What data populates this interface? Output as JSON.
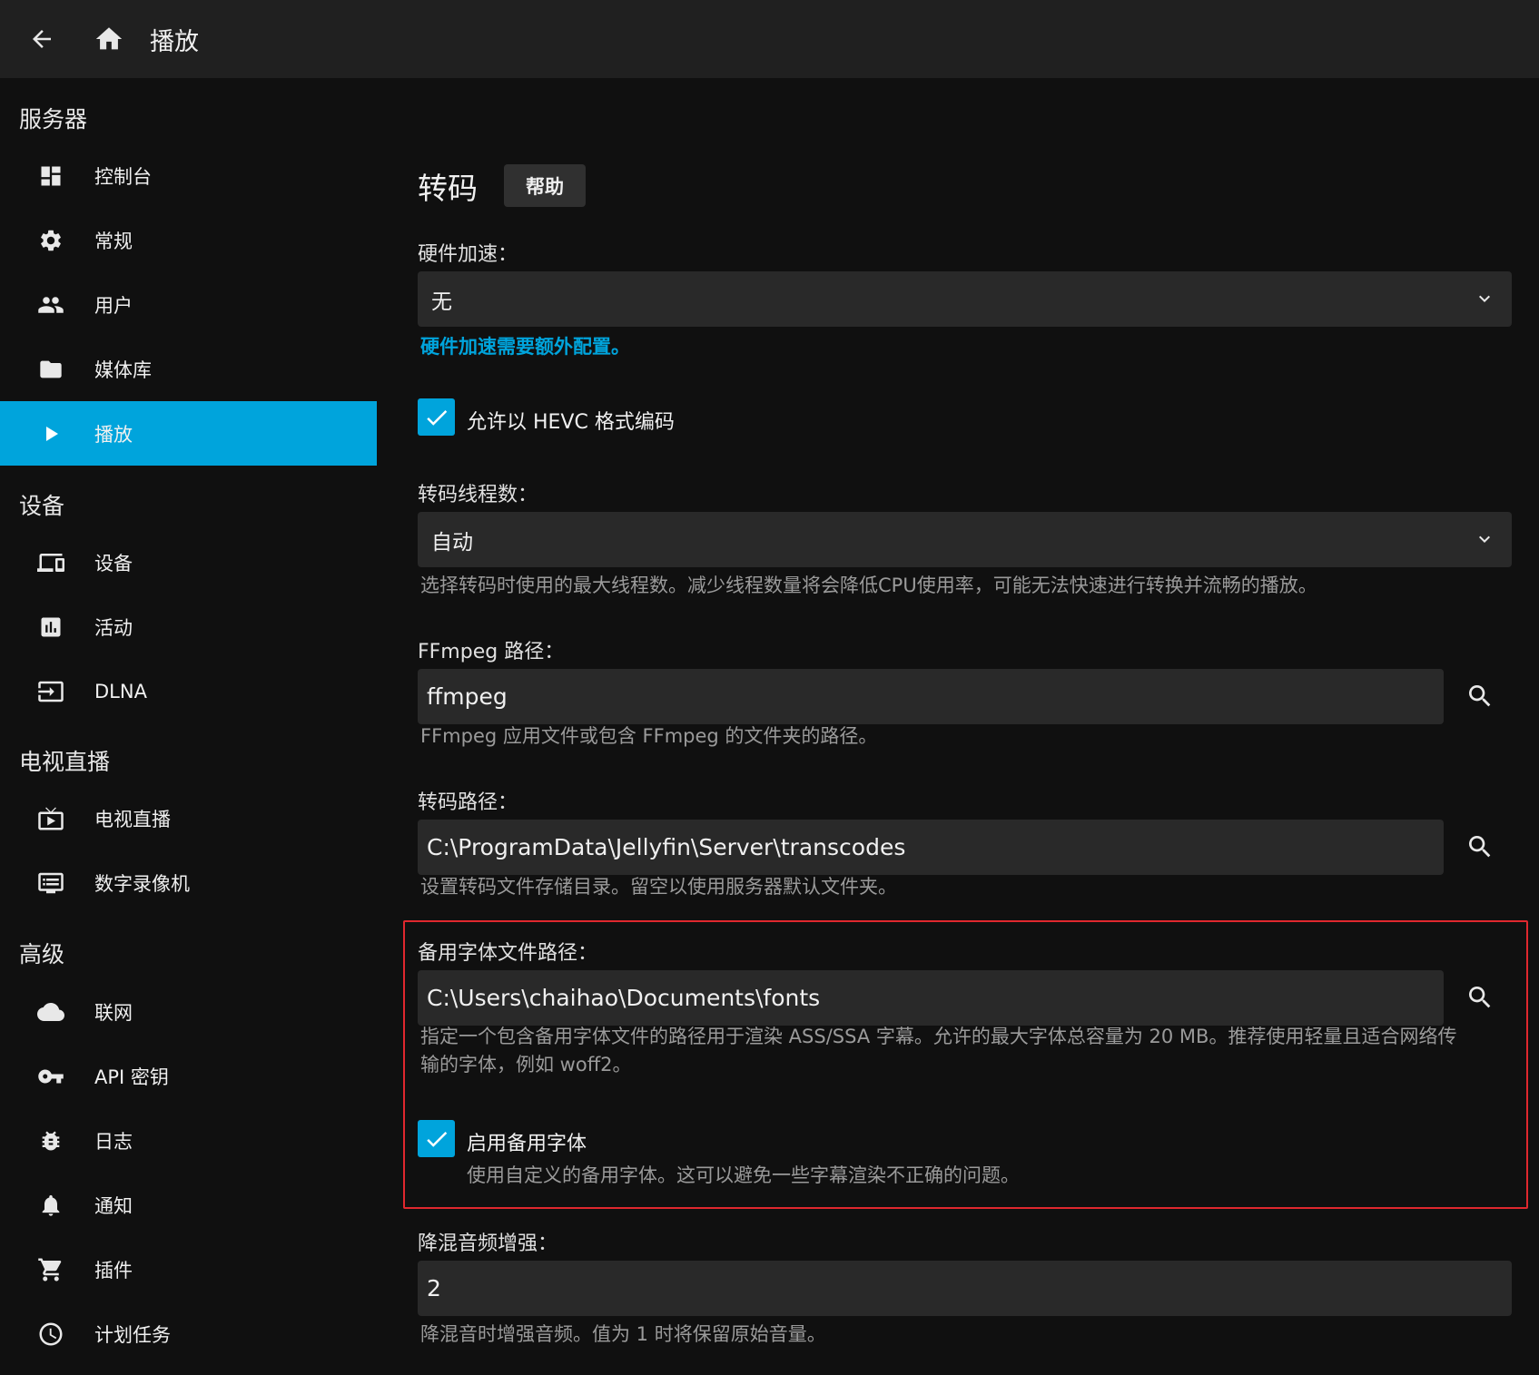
{
  "topbar": {
    "title": "播放",
    "back_icon": "arrow-left-icon",
    "home_icon": "home-icon"
  },
  "sidebar": {
    "sections": [
      {
        "header": "服务器",
        "items": [
          {
            "label": "控制台",
            "icon": "dashboard-icon"
          },
          {
            "label": "常规",
            "icon": "gear-icon"
          },
          {
            "label": "用户",
            "icon": "people-icon"
          },
          {
            "label": "媒体库",
            "icon": "folder-icon"
          },
          {
            "label": "播放",
            "icon": "play-icon",
            "active": true
          }
        ]
      },
      {
        "header": "设备",
        "items": [
          {
            "label": "设备",
            "icon": "devices-icon"
          },
          {
            "label": "活动",
            "icon": "chart-icon"
          },
          {
            "label": "DLNA",
            "icon": "input-icon"
          }
        ]
      },
      {
        "header": "电视直播",
        "items": [
          {
            "label": "电视直播",
            "icon": "tv-icon"
          },
          {
            "label": "数字录像机",
            "icon": "dvr-icon"
          }
        ]
      },
      {
        "header": "高级",
        "items": [
          {
            "label": "联网",
            "icon": "cloud-icon"
          },
          {
            "label": "API 密钥",
            "icon": "key-icon"
          },
          {
            "label": "日志",
            "icon": "bug-icon"
          },
          {
            "label": "通知",
            "icon": "bell-icon"
          },
          {
            "label": "插件",
            "icon": "cart-icon"
          },
          {
            "label": "计划任务",
            "icon": "clock-icon"
          }
        ]
      }
    ]
  },
  "main": {
    "title": "转码",
    "help_label": "帮助",
    "hw_accel": {
      "label": "硬件加速：",
      "value": "无",
      "link": "硬件加速需要额外配置。"
    },
    "hevc": {
      "label": "允许以 HEVC 格式编码",
      "checked": true
    },
    "threads": {
      "label": "转码线程数：",
      "value": "自动",
      "desc": "选择转码时使用的最大线程数。减少线程数量将会降低CPU使用率，可能无法快速进行转换并流畅的播放。"
    },
    "ffmpeg": {
      "label": "FFmpeg 路径：",
      "value": "ffmpeg",
      "desc": "FFmpeg 应用文件或包含 FFmpeg 的文件夹的路径。"
    },
    "transcode_path": {
      "label": "转码路径：",
      "value": "C:\\ProgramData\\Jellyfin\\Server\\transcodes",
      "desc": "设置转码文件存储目录。留空以使用服务器默认文件夹。"
    },
    "fallback_font": {
      "label": "备用字体文件路径：",
      "value": "C:\\Users\\chaihao\\Documents\\fonts",
      "desc_line1": "指定一个包含备用字体文件的路径用于渲染 ASS/SSA 字幕。允许的最大字体总容量为 20 MB。推荐使用轻量且适合网络传",
      "desc_line2": "输的字体，例如 woff2。"
    },
    "enable_fallback": {
      "label": "启用备用字体",
      "checked": true,
      "desc": "使用自定义的备用字体。这可以避免一些字幕渲染不正确的问题。"
    },
    "downmix": {
      "label": "降混音频增强：",
      "value": "2",
      "desc": "降混音时增强音频。值为 1 时将保留原始音量。"
    }
  },
  "colors": {
    "accent": "#00a4dc",
    "highlight": "#e0282e",
    "bg": "#101010",
    "topbar": "#202020",
    "field": "#292929"
  }
}
